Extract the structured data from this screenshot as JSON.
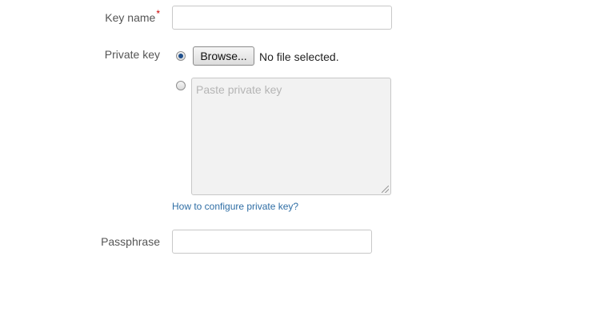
{
  "form": {
    "key_name": {
      "label": "Key name",
      "required_marker": "*",
      "value": ""
    },
    "private_key": {
      "label": "Private key",
      "file_option": {
        "selected": true,
        "browse_label": "Browse...",
        "file_status": "No file selected."
      },
      "paste_option": {
        "selected": false,
        "placeholder": "Paste private key",
        "value": ""
      },
      "help_link": "How to configure private key?"
    },
    "passphrase": {
      "label": "Passphrase",
      "value": ""
    }
  },
  "colors": {
    "link": "#2f6ea5",
    "required": "#cc0000",
    "input_border": "#c8c8c8",
    "textarea_background": "#f2f2f2",
    "radio_dot": "#1f4f8c"
  }
}
